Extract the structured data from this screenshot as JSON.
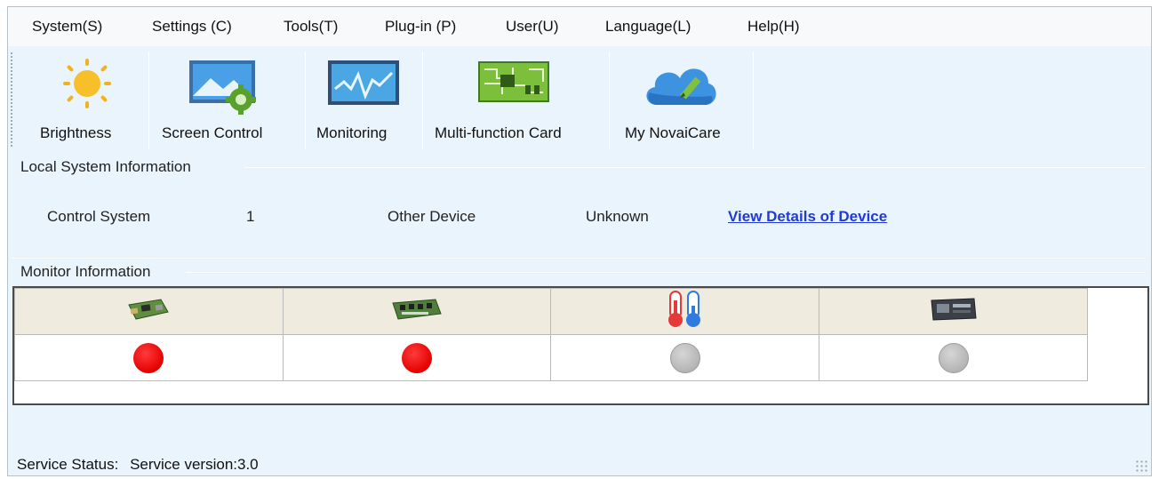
{
  "menu": [
    {
      "label": "System(S)"
    },
    {
      "label": "Settings (C)"
    },
    {
      "label": "Tools(T)"
    },
    {
      "label": "Plug-in (P)"
    },
    {
      "label": "User(U)"
    },
    {
      "label": "Language(L)"
    },
    {
      "label": "Help(H)"
    }
  ],
  "toolbar": [
    {
      "label": "Brightness",
      "icon": "sun-icon"
    },
    {
      "label": "Screen Control",
      "icon": "screen-control-icon"
    },
    {
      "label": "Monitoring",
      "icon": "monitoring-icon"
    },
    {
      "label": "Multi-function Card",
      "icon": "circuit-board-icon"
    },
    {
      "label": "My NovaiCare",
      "icon": "cloud-pen-icon"
    }
  ],
  "local_system": {
    "title": "Local System Information",
    "control_system_label": "Control System",
    "control_system_value": "1",
    "other_device_label": "Other Device",
    "other_device_value": "Unknown",
    "details_link": "View Details of Device"
  },
  "monitor": {
    "title": "Monitor Information",
    "columns": [
      {
        "icon": "sending-card-icon",
        "status": "error",
        "status_color": "#e40000"
      },
      {
        "icon": "receiving-card-icon",
        "status": "error",
        "status_color": "#e40000"
      },
      {
        "icon": "thermometer-icon",
        "status": "unknown",
        "status_color": "#b2b2b2"
      },
      {
        "icon": "controller-device-icon",
        "status": "unknown",
        "status_color": "#b2b2b2"
      }
    ]
  },
  "status_bar": {
    "label": "Service Status:",
    "value": "Service version:3.0"
  },
  "colors": {
    "background": "#eaf4fc",
    "link": "#1f3ad6",
    "error": "#e40000",
    "unknown": "#b2b2b2"
  }
}
